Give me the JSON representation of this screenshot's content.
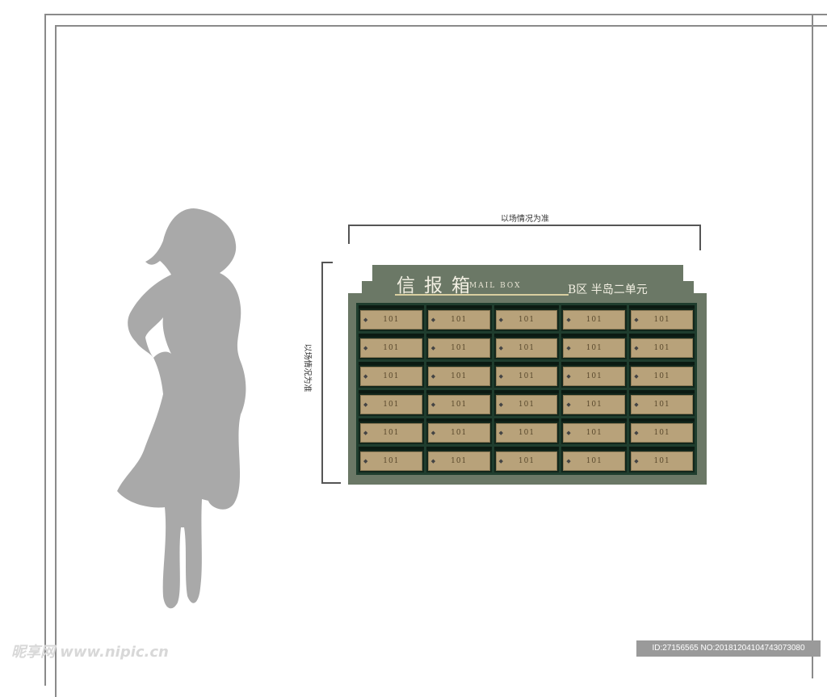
{
  "dimension_width_note": "以场情况为准",
  "dimension_height_note": "以场情况为准",
  "mailbox": {
    "title_cn": "信报箱",
    "title_en": "MAIL BOX",
    "area_label": "B区  半岛二单元",
    "colors": {
      "panel": "#6b7866",
      "grid": "#1f3d2e",
      "door": "#b8a27a"
    },
    "rows": [
      [
        "101",
        "101",
        "101",
        "101",
        "101"
      ],
      [
        "101",
        "101",
        "101",
        "101",
        "101"
      ],
      [
        "101",
        "101",
        "101",
        "101",
        "101"
      ],
      [
        "101",
        "101",
        "101",
        "101",
        "101"
      ],
      [
        "101",
        "101",
        "101",
        "101",
        "101"
      ],
      [
        "101",
        "101",
        "101",
        "101",
        "101"
      ]
    ]
  },
  "watermark": {
    "left_text": "昵享网 www.nipic.cn",
    "right_text": "ID:27156565 NO:20181204104743073080"
  }
}
